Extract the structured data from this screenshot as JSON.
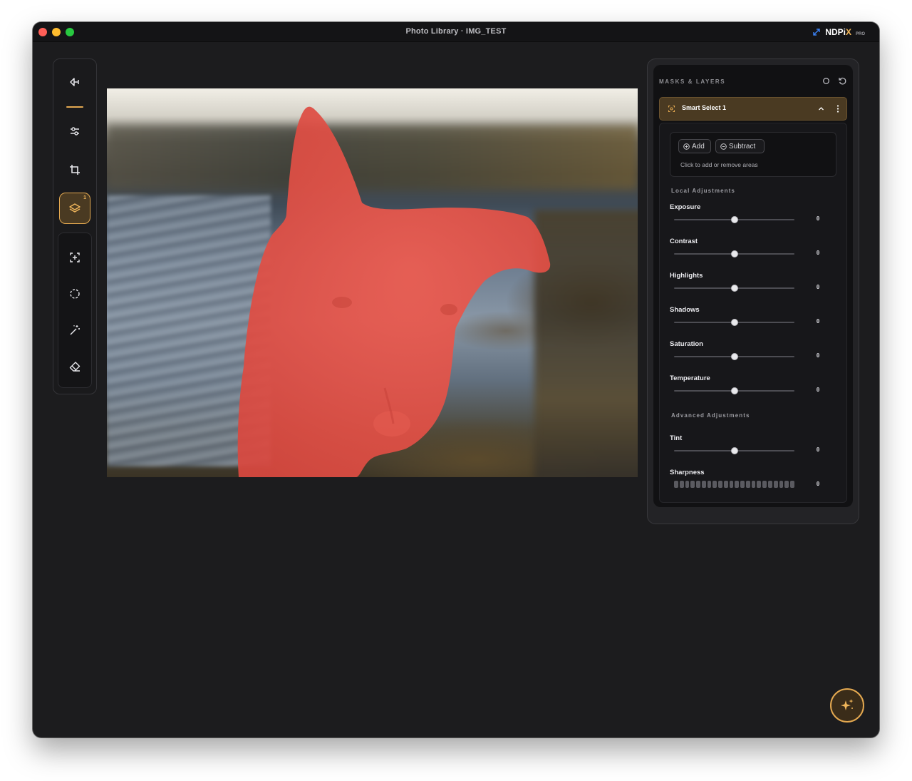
{
  "window": {
    "title": "Photo Library · IMG_TEST",
    "brand_name": "NDPi",
    "brand_x": "X",
    "brand_badge": "PRO",
    "accent_color": "#e3a850"
  },
  "toolbar": {
    "tools": [
      {
        "name": "back-arrow-icon"
      },
      {
        "name": "sliders-icon"
      },
      {
        "name": "crop-icon"
      },
      {
        "name": "layers-icon",
        "active": true,
        "badge": "1"
      },
      {
        "name": "smart-select-icon"
      },
      {
        "name": "lasso-icon"
      },
      {
        "name": "magic-wand-icon"
      },
      {
        "name": "eraser-icon"
      }
    ],
    "layers_badge": "1"
  },
  "panel": {
    "title": "MASKS & LAYERS",
    "layer": {
      "name": "Smart Select 1",
      "icon": "smart-select-icon"
    },
    "selector": {
      "add_label": "Add",
      "subtract_label": "Subtract",
      "hint": "Click to add or remove areas"
    },
    "local_section": "Local Adjustments",
    "advanced_section": "Advanced Adjustments",
    "adjustments": [
      {
        "label": "Exposure",
        "value": "0",
        "position": 0.5
      },
      {
        "label": "Contrast",
        "value": "0",
        "position": 0.5
      },
      {
        "label": "Highlights",
        "value": "0",
        "position": 0.5
      },
      {
        "label": "Shadows",
        "value": "0",
        "position": 0.5
      },
      {
        "label": "Saturation",
        "value": "0",
        "position": 0.5
      },
      {
        "label": "Temperature",
        "value": "0",
        "position": 0.5
      }
    ],
    "advanced": [
      {
        "label": "Tint",
        "value": "0",
        "position": 0.5
      },
      {
        "label": "Sharpness",
        "value": "0"
      }
    ]
  },
  "fab": {
    "icon": "sparkles-icon"
  }
}
